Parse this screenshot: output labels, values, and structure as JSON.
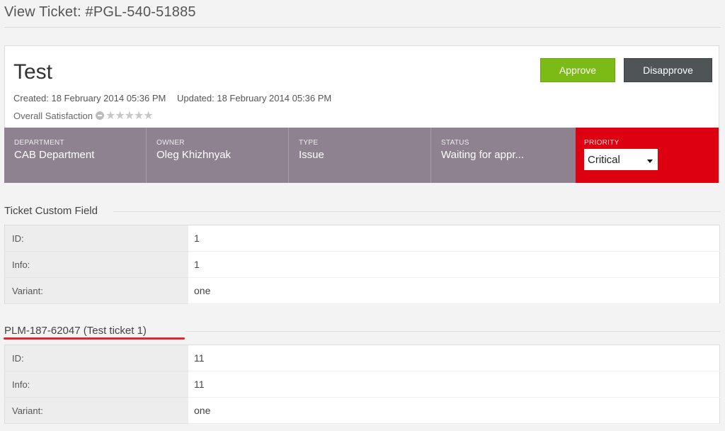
{
  "header": {
    "title": "View Ticket: #PGL-540-51885"
  },
  "ticket": {
    "subject": "Test",
    "created": "Created: 18 February 2014 05:36 PM",
    "updated": "Updated: 18 February 2014 05:36 PM",
    "satisfaction_label": "Overall Satisfaction",
    "satisfaction_stars": "★★★★★",
    "approve_label": "Approve",
    "disapprove_label": "Disapprove"
  },
  "info": {
    "department_label": "Department",
    "department_value": "CAB Department",
    "owner_label": "Owner",
    "owner_value": "Oleg Khizhnyak",
    "type_label": "Type",
    "type_value": "Issue",
    "status_label": "Status",
    "status_value": "Waiting for appr...",
    "priority_label": "Priority",
    "priority_value": "Critical"
  },
  "custom_fields": {
    "title": "Ticket Custom Field",
    "rows": [
      {
        "key": "ID:",
        "value": "1"
      },
      {
        "key": "Info:",
        "value": "1"
      },
      {
        "key": "Variant:",
        "value": "one"
      }
    ]
  },
  "linked": {
    "title": "PLM-187-62047 (Test ticket 1)",
    "rows": [
      {
        "key": "ID:",
        "value": "11"
      },
      {
        "key": "Info:",
        "value": "11"
      },
      {
        "key": "Variant:",
        "value": "one"
      }
    ]
  },
  "colors": {
    "approve": "#7cbb16",
    "disapprove": "#4f5456",
    "info_bar": "#8e8291",
    "priority_critical": "#dc0011",
    "annotation_underline": "#e3262c"
  }
}
